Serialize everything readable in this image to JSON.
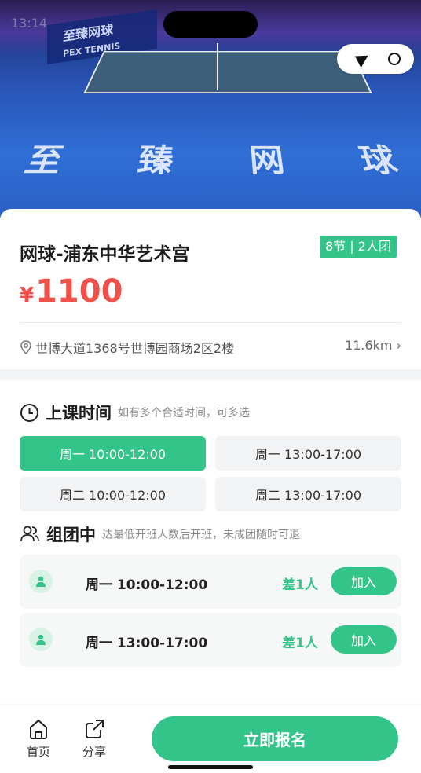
{
  "status_bar": {
    "time": "13:14"
  },
  "hero": {
    "banner_text": "至臻网球",
    "banner_sub": "PEX TENNIS",
    "court_text": [
      "至",
      "臻",
      "网",
      "球"
    ]
  },
  "course": {
    "title": "网球-浦东中华艺术宫",
    "badge": "8节 | 2人团",
    "currency": "¥",
    "price": "1100",
    "address": "世博大道1368号世博园商场2区2楼",
    "distance": "11.6km ›"
  },
  "schedule": {
    "heading": "上课时间",
    "hint": "如有多个合适时间，可多选",
    "slots": [
      {
        "label": "周一 10:00-12:00",
        "selected": true
      },
      {
        "label": "周一 13:00-17:00",
        "selected": false
      },
      {
        "label": "周二 10:00-12:00",
        "selected": false
      },
      {
        "label": "周二 13:00-17:00",
        "selected": false
      }
    ]
  },
  "groups": {
    "heading": "组团中",
    "hint": "达最低开班人数后开班，未成团随时可退",
    "items": [
      {
        "time": "周一 10:00-12:00",
        "need": "差1人",
        "join": "加入"
      },
      {
        "time": "周一 13:00-17:00",
        "need": "差1人",
        "join": "加入"
      }
    ]
  },
  "bottom_bar": {
    "home": "首页",
    "share": "分享",
    "signup": "立即报名"
  },
  "colors": {
    "accent": "#33c48a",
    "price": "#f0504a"
  }
}
